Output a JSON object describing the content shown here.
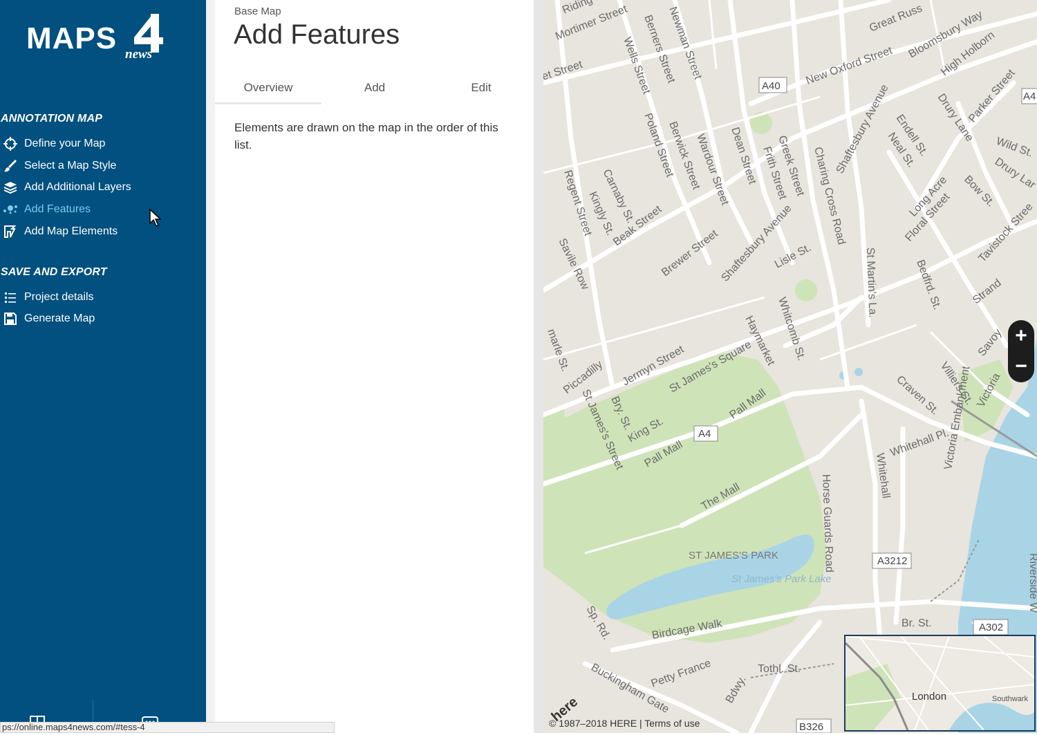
{
  "brand": {
    "logo_main": "MAPS",
    "logo_sub": "news"
  },
  "sidebar": {
    "sections": [
      {
        "title": "ANNOTATION MAP",
        "items": [
          {
            "label": "Define your Map",
            "icon": "crosshair-icon"
          },
          {
            "label": "Select a Map Style",
            "icon": "brush-icon"
          },
          {
            "label": "Add Additional Layers",
            "icon": "layers-icon"
          },
          {
            "label": "Add Features",
            "icon": "features-icon",
            "active": true
          },
          {
            "label": "Add Map Elements",
            "icon": "map-elements-icon"
          }
        ]
      },
      {
        "title": "SAVE AND EXPORT",
        "items": [
          {
            "label": "Project details",
            "icon": "list-icon"
          },
          {
            "label": "Generate Map",
            "icon": "save-icon"
          }
        ]
      }
    ],
    "bottom_icons": [
      "grid-icon",
      "chat-icon"
    ]
  },
  "panel": {
    "breadcrumb": "Base Map",
    "title": "Add Features",
    "tabs": [
      {
        "label": "Overview",
        "active": true
      },
      {
        "label": "Add"
      },
      {
        "label": "Edit"
      }
    ],
    "info_text": "Elements are drawn on the map in the order of this list."
  },
  "map": {
    "labels": {
      "mortimer": "Mortimer Street",
      "riding": "Riding",
      "berners": "Berners Street",
      "newman": "Newman Street",
      "wells": "Wells Street",
      "great_russell": "Great Russ",
      "bloomsbury": "Bloomsbury Way",
      "new_oxford": "New Oxford Street",
      "high_holborn": "High Holborn",
      "a40": "A40",
      "a4_top": "A4",
      "et_street": "et Street",
      "regent": "Regent Street",
      "poland": "Poland Street",
      "berwick": "Berwick Street",
      "wardour": "Wardour Street",
      "dean": "Dean Street",
      "frith": "Frith Street",
      "greek": "Greek Street",
      "charing_cross": "Charing Cross Road",
      "shaftesbury_top": "Shaftesbury Avenue",
      "endell": "Endell St.",
      "neal": "Neal St.",
      "drury_lane": "Drury Lane",
      "parker": "Parker Street",
      "wild": "Wild St.",
      "drury_lar": "Drury Lar",
      "carnaby": "Carnaby St.",
      "kingly": "Kingly St.",
      "beak": "Beak Street",
      "brewer": "Brewer Street",
      "shaftesbury": "Shaftesbury Avenue",
      "long_acre": "Long Acre",
      "floral": "Floral Street",
      "bow": "Bow St.",
      "tavistock": "Tavistock Stree",
      "savile": "Savile Row",
      "lisle": "Lisle St.",
      "st_martins": "St Martin's La.",
      "bedford": "Bedfrd. St.",
      "strand": "Strand",
      "haymarket": "Haymarket",
      "whitcomb": "Whitcomb St.",
      "savoy": "Savoy",
      "jermyn": "Jermyn Street",
      "piccadilly": "Piccadilly",
      "st_james_street": "St James's Street",
      "bry": "Bry. St.",
      "king": "King St.",
      "st_james_sq": "St James's Square",
      "pall_mall": "Pall Mall",
      "pall_mall_2": "Pall Mall",
      "a4": "A4",
      "craven": "Craven St.",
      "villiers": "Villiers St.",
      "victoria": "Victoria",
      "whitehall_pl": "Whitehall Pl.",
      "whitehall": "Whitehall",
      "the_mall": "The Mall",
      "horse_guards": "Horse Guards Road",
      "victoria_emb": "Victoria Embankment",
      "park": "ST JAMES'S PARK",
      "lake": "St James's Park Lake",
      "a3212": "A3212",
      "a302": "A302",
      "birdcage": "Birdcage Walk",
      "br_st": "Br. St.",
      "buckingham_gate": "Buckingham Gate",
      "petty_france": "Petty France",
      "tothl": "Tothl. St.",
      "bdwy": "Bdwy.",
      "b326": "B326",
      "riverside": "Riverside W",
      "sp_rd": "Sp. Rd.",
      "marle": "marle St."
    },
    "zoom_in": "+",
    "zoom_out": "−",
    "attribution": "© 1987–2018 HERE | ",
    "terms": "Terms of use",
    "here_logo": "here",
    "minimap": {
      "london": "London",
      "southwark": "Southwark"
    }
  },
  "statusbar": {
    "url": "ps://online.maps4news.com/#tess-4"
  },
  "colors": {
    "sidebar": "#01507f",
    "active_item": "#7fc8f0",
    "map_land": "#e8e4de",
    "park": "#cfe3b8",
    "water": "#a9d4e6",
    "road": "#ffffff"
  }
}
